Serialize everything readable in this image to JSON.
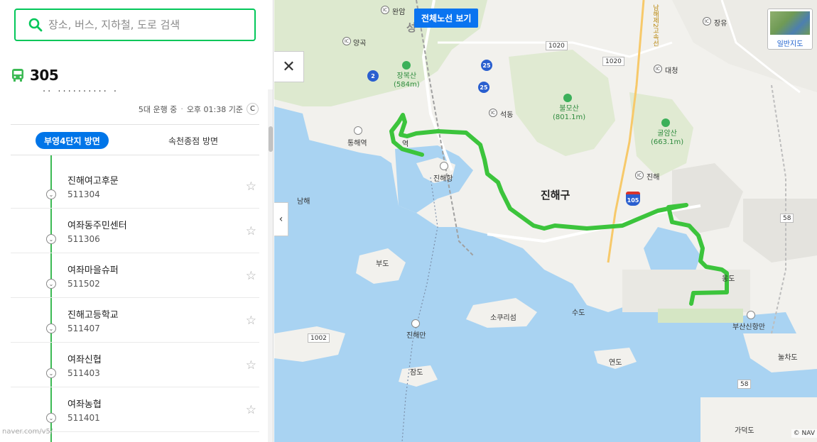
{
  "search": {
    "placeholder": "장소, 버스, 지하철, 도로 검색"
  },
  "route": {
    "number": "305",
    "cut_text": "·· ·········· ·",
    "vehicles_running": "5대 운행 중",
    "separator": "·",
    "updated": "오후 01:38 기준",
    "directions": {
      "active": "부영4단지 방면",
      "other": "속천종점 방면"
    }
  },
  "stops": [
    {
      "name": "진해여고후문",
      "code": "511304"
    },
    {
      "name": "여좌동주민센터",
      "code": "511306"
    },
    {
      "name": "여좌마을슈퍼",
      "code": "511502"
    },
    {
      "name": "진해고등학교",
      "code": "511407"
    },
    {
      "name": "여좌신협",
      "code": "511403"
    },
    {
      "name": "여좌농협",
      "code": "511401"
    }
  ],
  "url_hint": "naver.com/v5/",
  "map": {
    "full_route_button": "전체노선 보기",
    "map_type_label": "일반지도",
    "copyright": "© NAV",
    "route_color": "#3cc43c",
    "water_color": "#a9d3f2",
    "land_color": "#f2f1ed",
    "labels": {
      "district": "진해구",
      "mtn_jangbok": "장복산",
      "mtn_jangbok_h": "(584m)",
      "mtn_bulmo": "불모산",
      "mtn_bulmo_h": "(801.1m)",
      "mtn_gulam": "굴암산",
      "mtn_gulam_h": "(663.1m)",
      "wanam": "완암",
      "yanggok": "양곡",
      "seokdong": "석동",
      "jangyu": "장유",
      "daecheong": "대청",
      "jinhae_ic": "진해",
      "tonghae_stn": "통해역",
      "jinhae_port": "진해항",
      "namhae": "남해",
      "budo": "부도",
      "sokurisom": "소쿠리섬",
      "sudo": "수도",
      "jinhaeman": "진해만",
      "yeondo": "연도",
      "jamdo": "잠도",
      "busan_newport": "부산신항만",
      "nulchado": "눌차도",
      "gadeokdo": "가덕도",
      "station_frag": "역",
      "ungdong": "웅도",
      "seongju": "성",
      "expressway": "남해제2고속선",
      "road_1020a": "1020",
      "road_1020b": "1020",
      "road_1002": "1002",
      "road_58a": "58",
      "road_58b": "58",
      "road_2": "2",
      "road_25a": "25",
      "road_25b": "25",
      "road_105": "105",
      "ic": "IC"
    }
  }
}
